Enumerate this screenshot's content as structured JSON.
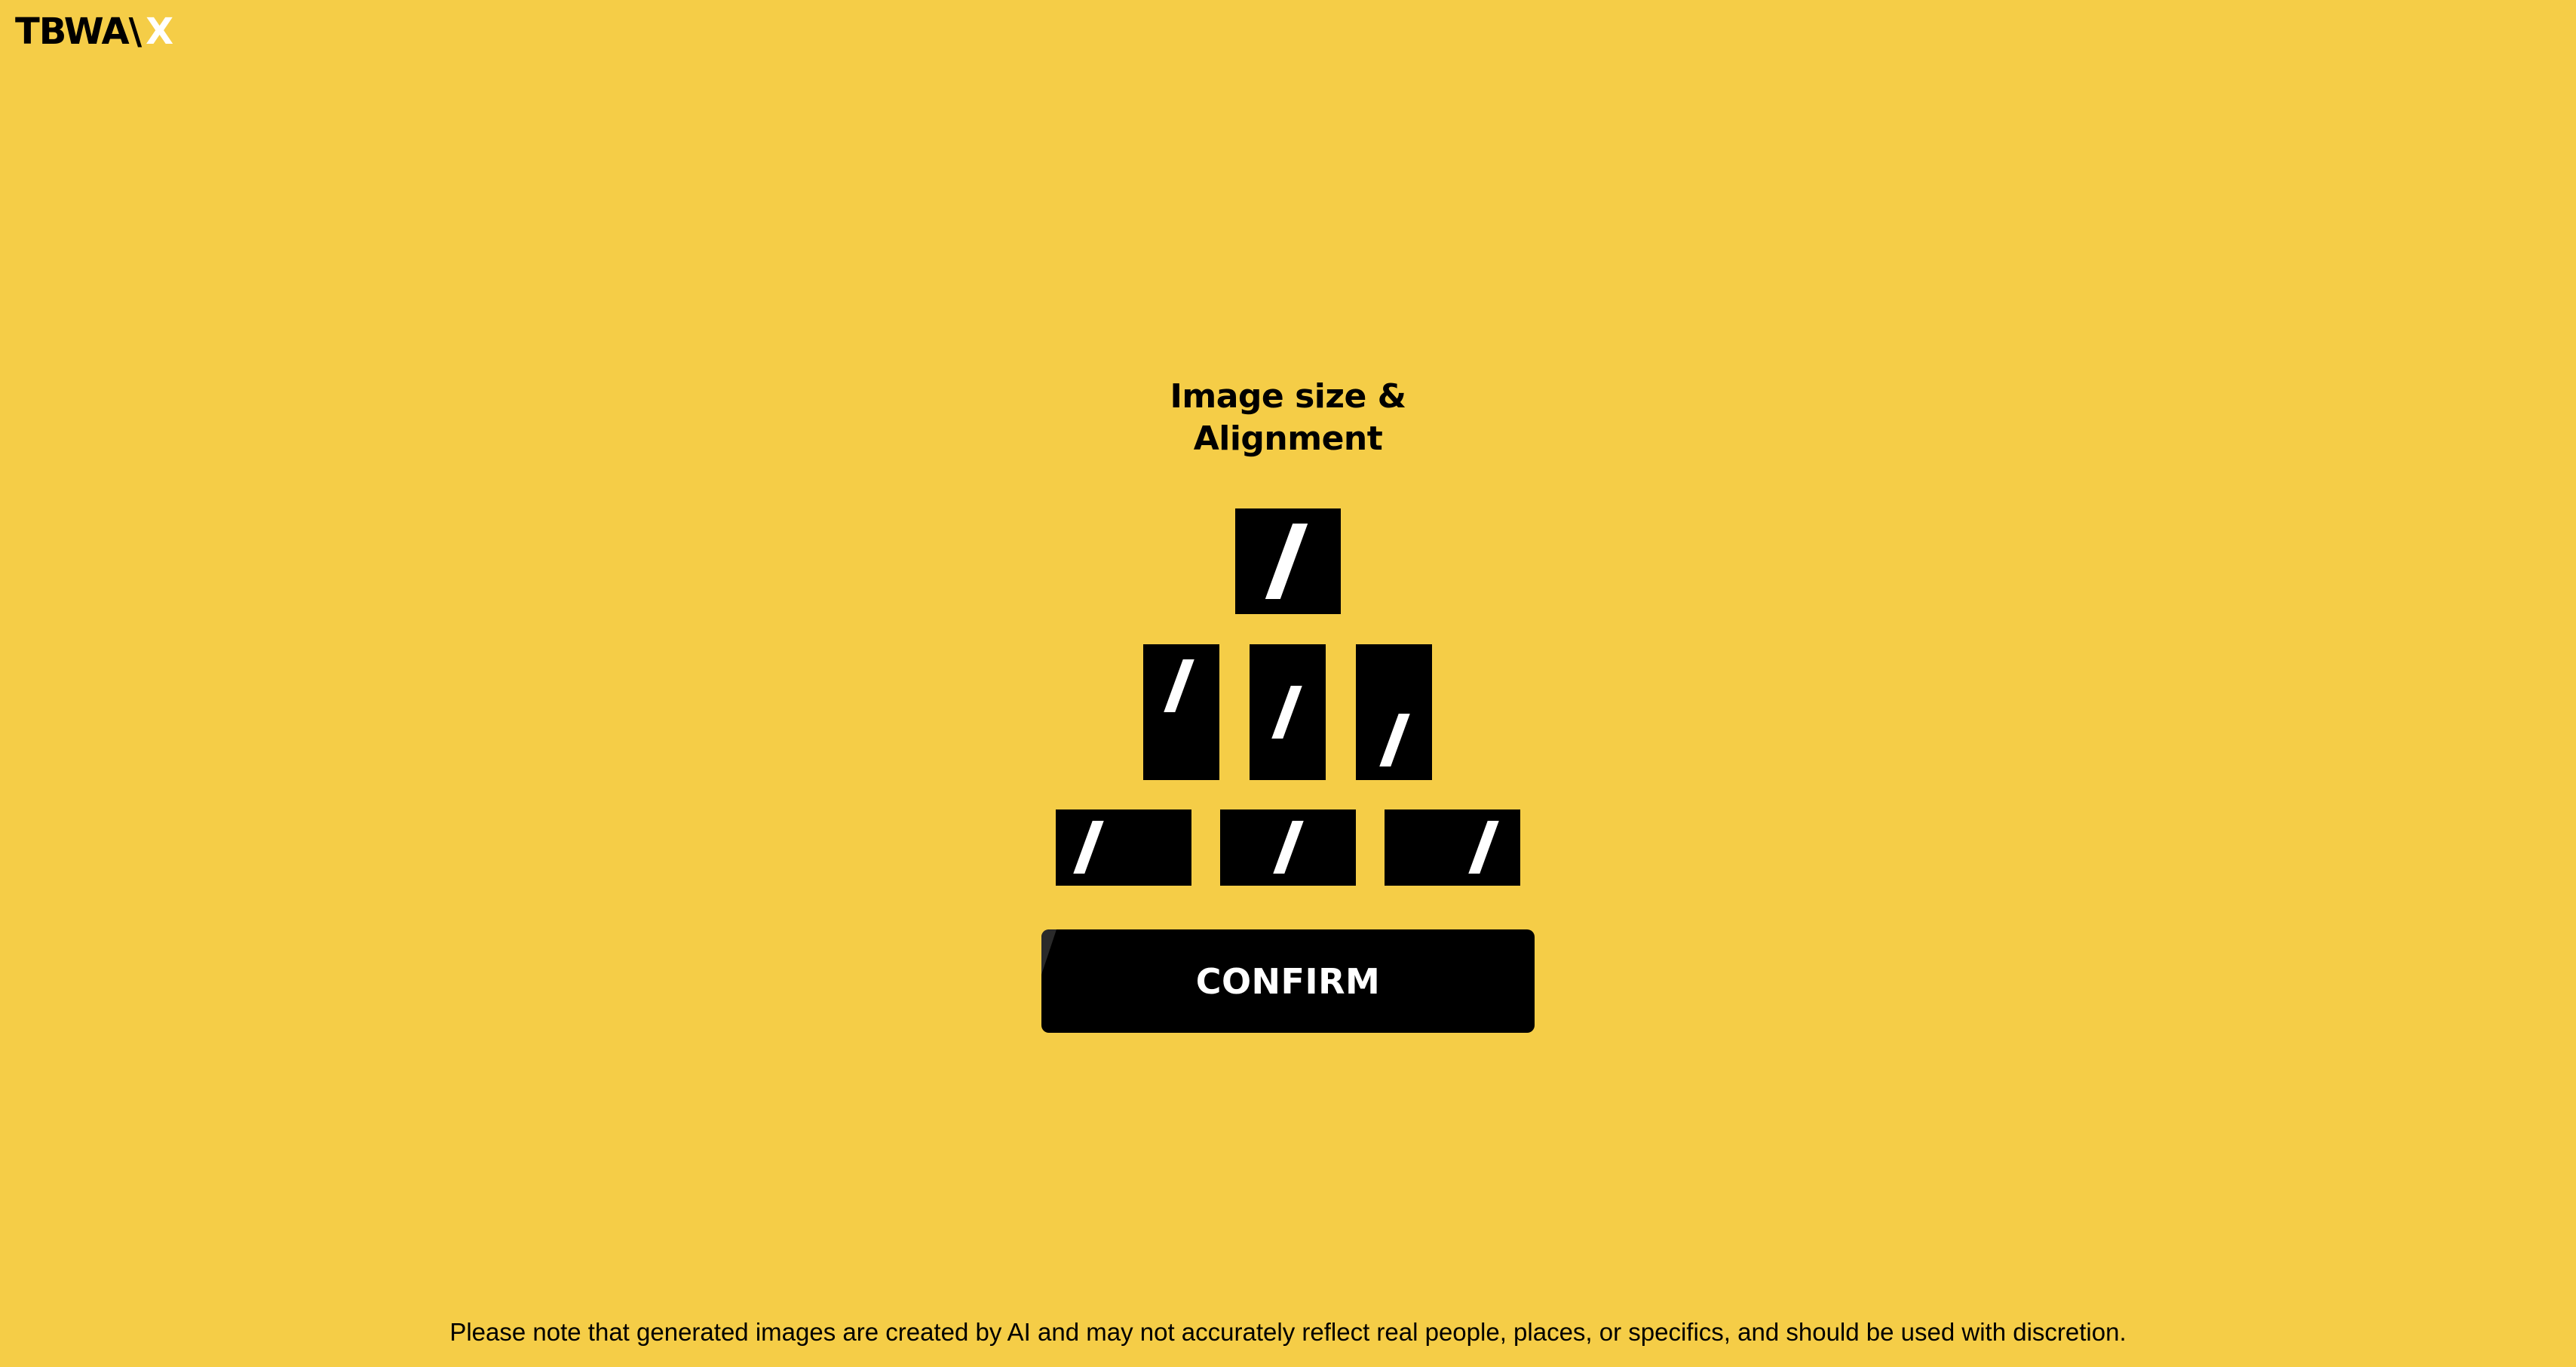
{
  "brand": {
    "wordmark": "TBWA\\",
    "suffix": "X"
  },
  "page": {
    "title_line1": "Image size &",
    "title_line2": "Alignment"
  },
  "tiles": [
    {
      "id": "square-center",
      "aspect": "square",
      "alignment": "center"
    },
    {
      "id": "portrait-top",
      "aspect": "portrait",
      "alignment": "top"
    },
    {
      "id": "portrait-center",
      "aspect": "portrait",
      "alignment": "center"
    },
    {
      "id": "portrait-bottom",
      "aspect": "portrait",
      "alignment": "bottom"
    },
    {
      "id": "landscape-left",
      "aspect": "landscape",
      "alignment": "left"
    },
    {
      "id": "landscape-center",
      "aspect": "landscape",
      "alignment": "center"
    },
    {
      "id": "landscape-right",
      "aspect": "landscape",
      "alignment": "right"
    }
  ],
  "confirm_label": "CONFIRM",
  "disclaimer": "Please note that generated images are created by AI and may not accurately reflect real people, places, or specifics, and should be used with discretion.",
  "colors": {
    "background": "#F5CD47",
    "tile": "#000000",
    "mark": "#FFFFFF"
  }
}
